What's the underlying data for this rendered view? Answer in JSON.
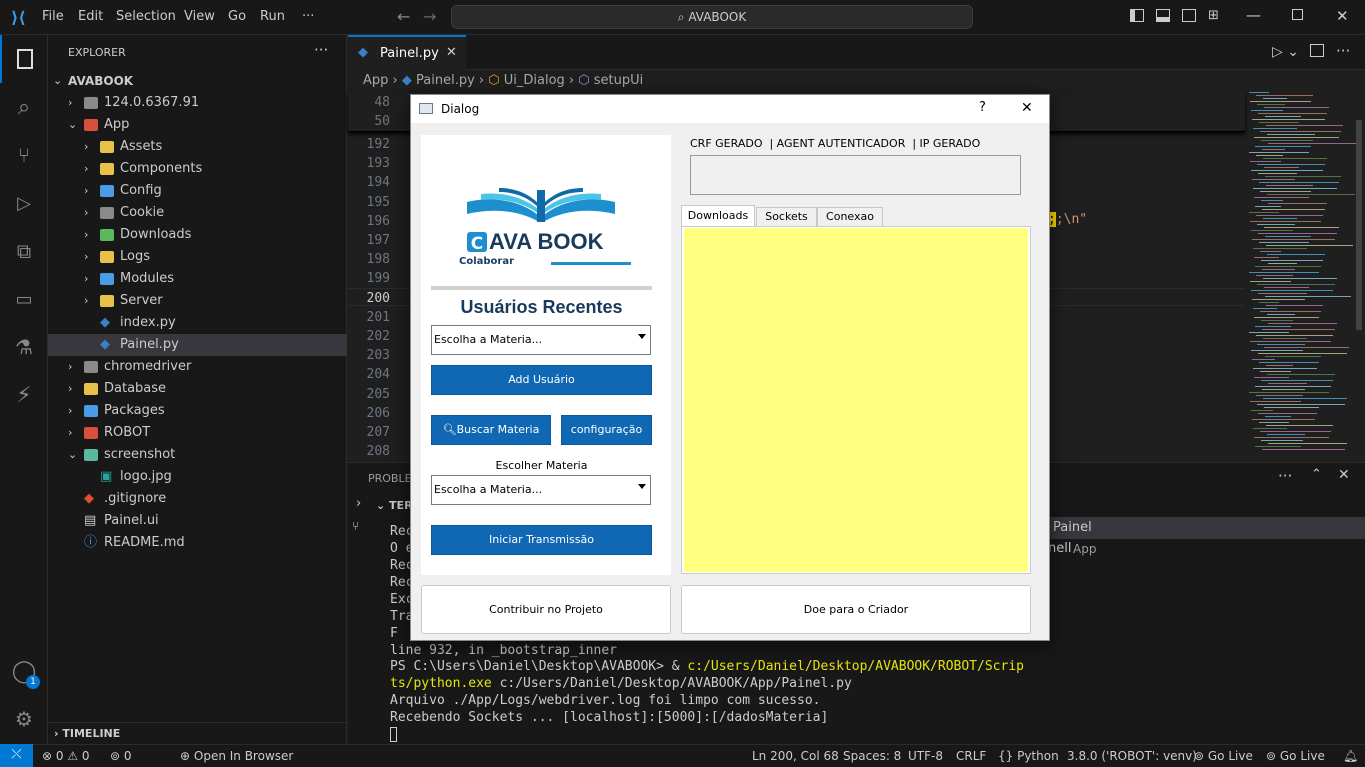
{
  "titlebar": {
    "menus": [
      "File",
      "Edit",
      "Selection",
      "View",
      "Go",
      "Run",
      "···"
    ],
    "search": "AVABOOK"
  },
  "sidebar": {
    "header": "EXPLORER",
    "root": "AVABOOK",
    "items": [
      {
        "label": "124.0.6367.91",
        "kind": "folder",
        "depth": 1,
        "open": false,
        "color": "#8a8a8a"
      },
      {
        "label": "App",
        "kind": "folder",
        "depth": 1,
        "open": true,
        "color": "#d84f3c"
      },
      {
        "label": "Assets",
        "kind": "folder",
        "depth": 2,
        "open": false,
        "color": "#e8c14a"
      },
      {
        "label": "Components",
        "kind": "folder",
        "depth": 2,
        "open": false,
        "color": "#e8c14a"
      },
      {
        "label": "Config",
        "kind": "folder",
        "depth": 2,
        "open": false,
        "color": "#4a9be8"
      },
      {
        "label": "Cookie",
        "kind": "folder",
        "depth": 2,
        "open": false,
        "color": "#8a8a8a"
      },
      {
        "label": "Downloads",
        "kind": "folder",
        "depth": 2,
        "open": false,
        "color": "#5bb85b"
      },
      {
        "label": "Logs",
        "kind": "folder",
        "depth": 2,
        "open": false,
        "color": "#e8c14a"
      },
      {
        "label": "Modules",
        "kind": "folder",
        "depth": 2,
        "open": false,
        "color": "#4a9be8"
      },
      {
        "label": "Server",
        "kind": "folder",
        "depth": 2,
        "open": false,
        "color": "#e8c14a"
      },
      {
        "label": "index.py",
        "kind": "py",
        "depth": 2
      },
      {
        "label": "Painel.py",
        "kind": "py",
        "depth": 2,
        "selected": true
      },
      {
        "label": "chromedriver",
        "kind": "folder",
        "depth": 1,
        "open": false,
        "color": "#8a8a8a"
      },
      {
        "label": "Database",
        "kind": "folder",
        "depth": 1,
        "open": false,
        "color": "#e8c14a"
      },
      {
        "label": "Packages",
        "kind": "folder",
        "depth": 1,
        "open": false,
        "color": "#4a9be8"
      },
      {
        "label": "ROBOT",
        "kind": "folder",
        "depth": 1,
        "open": false,
        "color": "#d84f3c"
      },
      {
        "label": "screenshot",
        "kind": "folder",
        "depth": 1,
        "open": true,
        "color": "#5bb8a0"
      },
      {
        "label": "logo.jpg",
        "kind": "img",
        "depth": 2
      },
      {
        "label": ".gitignore",
        "kind": "git",
        "depth": 1
      },
      {
        "label": "Painel.ui",
        "kind": "file",
        "depth": 1
      },
      {
        "label": "README.md",
        "kind": "info",
        "depth": 1
      }
    ],
    "timeline": "TIMELINE"
  },
  "editor": {
    "tab": "Painel.py",
    "breadcrumb": [
      "App",
      "Painel.py",
      "Ui_Dialog",
      "setupUi"
    ],
    "sticky_lines": [
      "48",
      "50"
    ],
    "lines": [
      "192",
      "193",
      "194",
      "195",
      "196",
      "197",
      "198",
      "199",
      "200",
      "201",
      "202",
      "203",
      "204",
      "205",
      "206",
      "207",
      "208"
    ],
    "current_line": "200",
    "snippet": ";\\n\""
  },
  "panel": {
    "tab_problems": "PROBLEM",
    "terminal_header": "TER",
    "terminal_lines": [
      "Rec",
      "O e",
      "Rec",
      "Rec",
      "Exc",
      "Tra",
      "  F",
      " line 932, in _bootstrap_inner"
    ],
    "ps_prompt": "PS C:\\Users\\Daniel\\Desktop\\AVABOOK> & ",
    "ps_cmd1": "c:/Users/Daniel/Desktop/AVABOOK/ROBOT/Scrip",
    "ps_cmd2": "ts/python.exe",
    "ps_cmd3": " c:/Users/Daniel/Desktop/AVABOOK/App/Painel.py",
    "out1": "Arquivo ./App/Logs/webdriver.log foi limpo com sucesso.",
    "out2": "Recebendo Sockets ... [localhost]:[5000]:[/dadosMateria]",
    "side_items": [
      "Painel",
      "nell",
      "App"
    ]
  },
  "status": {
    "errors": "0",
    "warnings": "0",
    "ports": "0",
    "open_browser": "Open In Browser",
    "position": "Ln 200, Col 68",
    "spaces": "Spaces: 8",
    "encoding": "UTF-8",
    "eol": "CRLF",
    "language": "Python",
    "interpreter": "3.8.0 ('ROBOT': venv)",
    "golive1": "Go Live",
    "golive2": "Go Live",
    "account_badge": "1"
  },
  "dialog": {
    "title": "Dialog",
    "help": "?",
    "close": "✕",
    "logo_title": "AVA BOOK",
    "logo_sub": "Colaborar",
    "logo_c": "C",
    "recent_title": "Usuários Recentes",
    "combo1": "Escolha a Materia...",
    "add_user": "Add Usuário",
    "search": "Buscar Materia",
    "config": "configuração",
    "choose_label": "Escolher Materia",
    "combo2": "Escolha a Materia...",
    "start": "Iniciar Transmissão",
    "header_label": "CRF GERADO  | AGENT AUTENTICADOR  | IP GERADO",
    "tabs": [
      "Downloads",
      "Sockets",
      "Conexao"
    ],
    "contribute": "Contribuir no Projeto",
    "donate": "Doe para o Criador",
    "colors": {
      "accent": "#1068b4",
      "yellow": "#ffff80"
    }
  }
}
